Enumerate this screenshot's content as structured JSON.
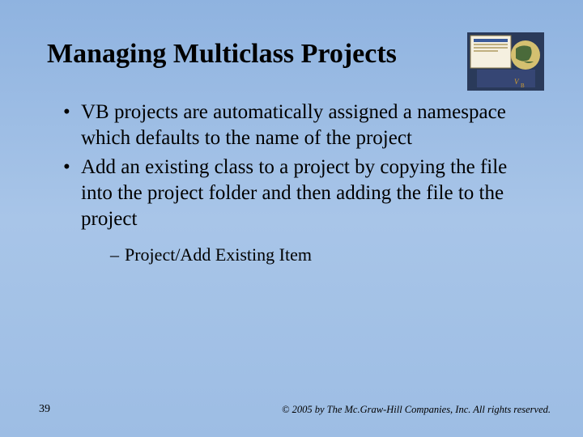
{
  "title": "Managing Multiclass Projects",
  "bullets": [
    "VB projects are automatically assigned a namespace which defaults to the name of the project",
    "Add an existing class to a project by copying the file into the project folder and then adding the file to the project"
  ],
  "sub_bullets": [
    "Project/Add Existing Item"
  ],
  "page_number": "39",
  "copyright": "© 2005 by The Mc.Graw-Hill Companies, Inc. All rights reserved.",
  "corner_graphic_name": "logo-vb-globe"
}
